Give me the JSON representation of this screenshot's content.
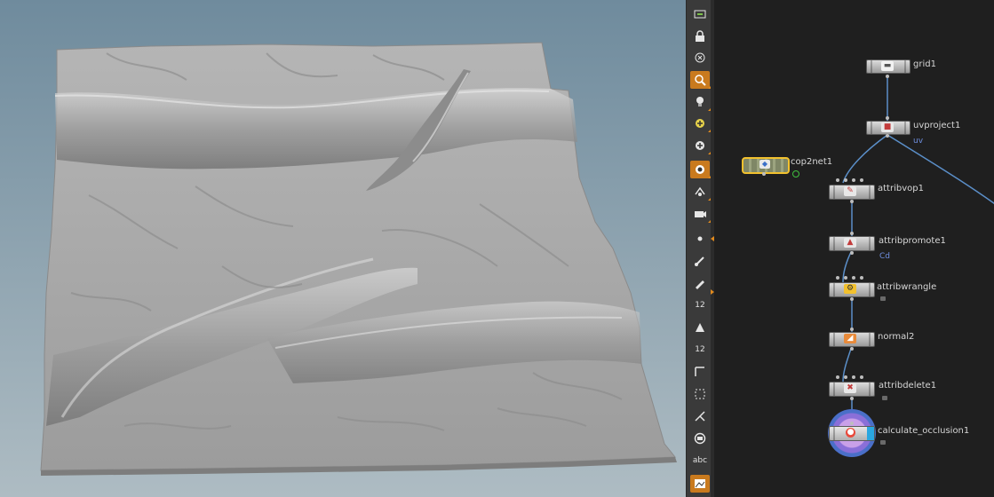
{
  "toolbar": {
    "items": [
      {
        "name": "select-view-icon",
        "active": false
      },
      {
        "name": "lock-icon",
        "active": false
      },
      {
        "name": "close-viewer-icon",
        "active": false
      },
      {
        "name": "magnify-icon",
        "active": true
      },
      {
        "name": "light-icon",
        "active": false
      },
      {
        "name": "add-light-icon",
        "active": false
      },
      {
        "name": "add-object-icon",
        "active": false
      },
      {
        "name": "snap-icon",
        "active": true
      },
      {
        "name": "pose-icon",
        "active": false
      },
      {
        "name": "camera-icon",
        "active": false
      },
      {
        "name": "point-display-icon",
        "active": false
      },
      {
        "name": "brush-icon",
        "active": false
      },
      {
        "name": "pen-icon",
        "active": false
      }
    ],
    "point_numbers_label": "12",
    "prim_numbers_label": "12",
    "text_label": "abc"
  },
  "network": {
    "nodes": [
      {
        "id": "grid1",
        "label": "grid1",
        "sub": ""
      },
      {
        "id": "uvproject1",
        "label": "uvproject1",
        "sub": "uv"
      },
      {
        "id": "cop2net1",
        "label": "cop2net1",
        "sub": ""
      },
      {
        "id": "attribvop1",
        "label": "attribvop1",
        "sub": ""
      },
      {
        "id": "attribpromote1",
        "label": "attribpromote1",
        "sub": "Cd"
      },
      {
        "id": "attribwrangle1",
        "label": "attribwrangle",
        "sub": ""
      },
      {
        "id": "normal2",
        "label": "normal2",
        "sub": ""
      },
      {
        "id": "attribdelete1",
        "label": "attribdelete1",
        "sub": ""
      },
      {
        "id": "calculate_occlusion1",
        "label": "calculate_occlusion1",
        "sub": ""
      }
    ]
  },
  "colors": {
    "accent": "#c97a1e",
    "selected_outline": "#f2c12e",
    "wire": "#5b8fc9",
    "attribute_text": "#6f8fe0",
    "viewport_top": "#6f8b9d",
    "viewport_bottom": "#aebcc3"
  }
}
